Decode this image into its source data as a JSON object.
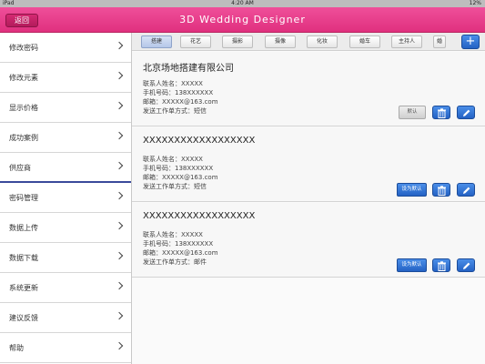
{
  "status_bar": {
    "left": "iPad",
    "time": "4:20 AM",
    "right": "12%"
  },
  "navbar": {
    "back_label": "返回",
    "title": "3D Wedding Designer"
  },
  "sidebar": {
    "items": [
      {
        "label": "修改密码"
      },
      {
        "label": "修改元素"
      },
      {
        "label": "显示价格"
      },
      {
        "label": "成功案例"
      },
      {
        "label": "供应商"
      },
      {
        "label": "密码管理"
      },
      {
        "label": "数据上传"
      },
      {
        "label": "数据下载"
      },
      {
        "label": "系统更新"
      },
      {
        "label": "建议反馈"
      },
      {
        "label": "帮助"
      }
    ],
    "active_index": 4
  },
  "tabs": [
    "搭建",
    "花艺",
    "摄影",
    "摄像",
    "化妆",
    "婚车",
    "主持人",
    "婚"
  ],
  "active_tab": 0,
  "add_button": "+",
  "suppliers": [
    {
      "name": "北京场地搭建有限公司",
      "contact": "联系人姓名：XXXXX",
      "phone": "手机号码：138XXXXXX",
      "email": "邮箱：XXXXX@163.com",
      "method": "发送工作单方式：短信",
      "default_label": "默认",
      "is_default": true
    },
    {
      "name": "XXXXXXXXXXXXXXXXXX",
      "contact": "联系人姓名：XXXXX",
      "phone": "手机号码：138XXXXXX",
      "email": "邮箱：XXXXX@163.com",
      "method": "发送工作单方式：短信",
      "default_label": "设为默认",
      "is_default": false
    },
    {
      "name": "XXXXXXXXXXXXXXXXXX",
      "contact": "联系人姓名：XXXXX",
      "phone": "手机号码：138XXXXXX",
      "email": "邮箱：XXXXX@163.com",
      "method": "发送工作单方式：邮件",
      "default_label": "设为默认",
      "is_default": false
    }
  ]
}
